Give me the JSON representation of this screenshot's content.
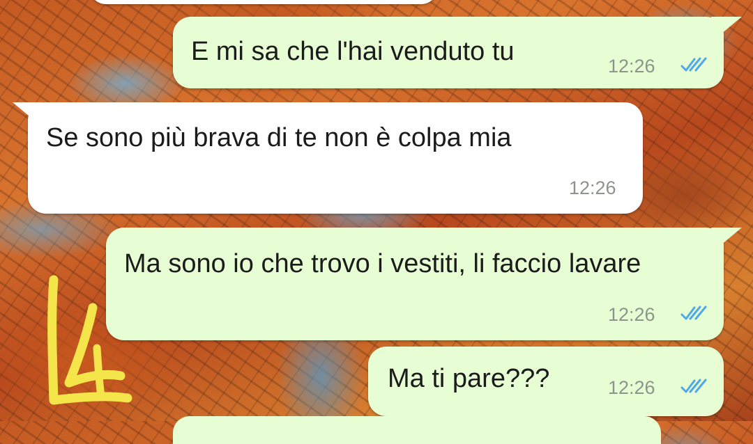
{
  "messages": [
    {
      "direction": "outgoing",
      "text": "E mi sa che l'hai venduto tu",
      "time": "12:26",
      "status": "read"
    },
    {
      "direction": "incoming",
      "text": "Se sono più brava di te non è colpa mia",
      "time": "12:26"
    },
    {
      "direction": "outgoing",
      "text": "Ma sono io che trovo i vestiti, li faccio lavare",
      "time": "12:26",
      "status": "read"
    },
    {
      "direction": "outgoing",
      "text": "Ma ti pare???",
      "time": "12:26",
      "status": "read"
    }
  ],
  "colors": {
    "outgoing_bubble": "#e7fdd3",
    "incoming_bubble": "#ffffff",
    "read_ticks": "#4fa8e8",
    "timestamp": "#8c958c",
    "annotation": "#f4e64a"
  },
  "wallpaper": "autumn-trees"
}
